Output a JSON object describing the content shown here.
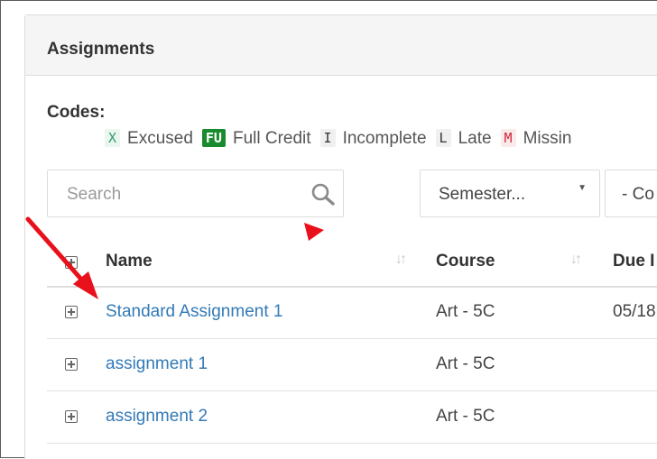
{
  "panel": {
    "title": "Assignments"
  },
  "codes": {
    "label": "Codes:",
    "items": [
      {
        "badge": "X",
        "text": "Excused"
      },
      {
        "badge": "FU",
        "text": "Full Credit"
      },
      {
        "badge": "I",
        "text": "Incomplete"
      },
      {
        "badge": "L",
        "text": "Late"
      },
      {
        "badge": "M",
        "text": "Missin"
      }
    ]
  },
  "filters": {
    "search_placeholder": "Search",
    "semester_select": "Semester...",
    "course_select": "- Co"
  },
  "table": {
    "headers": {
      "name": "Name",
      "course": "Course",
      "due": "Due I"
    },
    "rows": [
      {
        "name": "Standard Assignment 1",
        "course": "Art - 5C",
        "due": "05/18"
      },
      {
        "name": "assignment 1",
        "course": "Art - 5C",
        "due": ""
      },
      {
        "name": "assignment 2",
        "course": "Art - 5C",
        "due": ""
      }
    ]
  },
  "colors": {
    "link": "#337ab7",
    "annotation": "#e8101a",
    "full_credit_badge": "#1a8a2e"
  }
}
